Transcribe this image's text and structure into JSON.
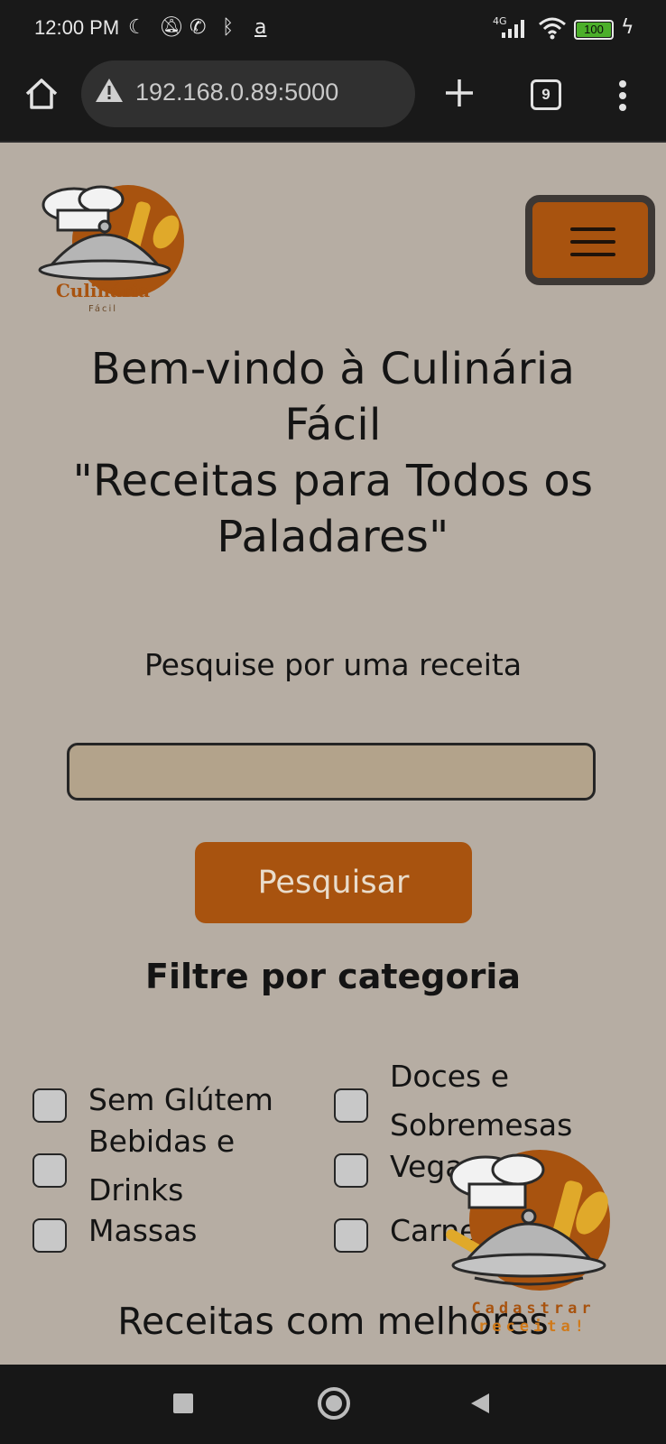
{
  "status_bar": {
    "time": "12:00 PM",
    "icons": [
      "moon-icon",
      "mute-icon",
      "whatsapp-icon",
      "bluetooth-icon",
      "amazon-icon"
    ],
    "network": "4G",
    "battery": "100"
  },
  "browser": {
    "url": "192.168.0.89:5000",
    "tab_count": "9"
  },
  "logo": {
    "text": "Culinária",
    "subtext": "Fácil"
  },
  "page": {
    "title_line1": "Bem-vindo à Culinária",
    "title_line2": "Fácil",
    "title_line3": "\"Receitas para Todos os",
    "title_line4": "Paladares\"",
    "search_label": "Pesquise por uma receita",
    "search_value": "",
    "search_button": "Pesquisar",
    "filter_title": "Filtre por categoria",
    "categories": [
      {
        "label": "Sem Glútem"
      },
      {
        "label": "Doces e Sobremesas"
      },
      {
        "label": "Bebidas e Drinks"
      },
      {
        "label": "Vegano"
      },
      {
        "label": "Massas"
      },
      {
        "label": "Carnes"
      }
    ],
    "best_recipes": "Receitas com melhores",
    "fab_label_line1": "Cadastrar",
    "fab_label_line2": "receita!"
  },
  "colors": {
    "background": "#b6ada3",
    "accent": "#a8530f",
    "input_bg": "#b3a38b"
  }
}
